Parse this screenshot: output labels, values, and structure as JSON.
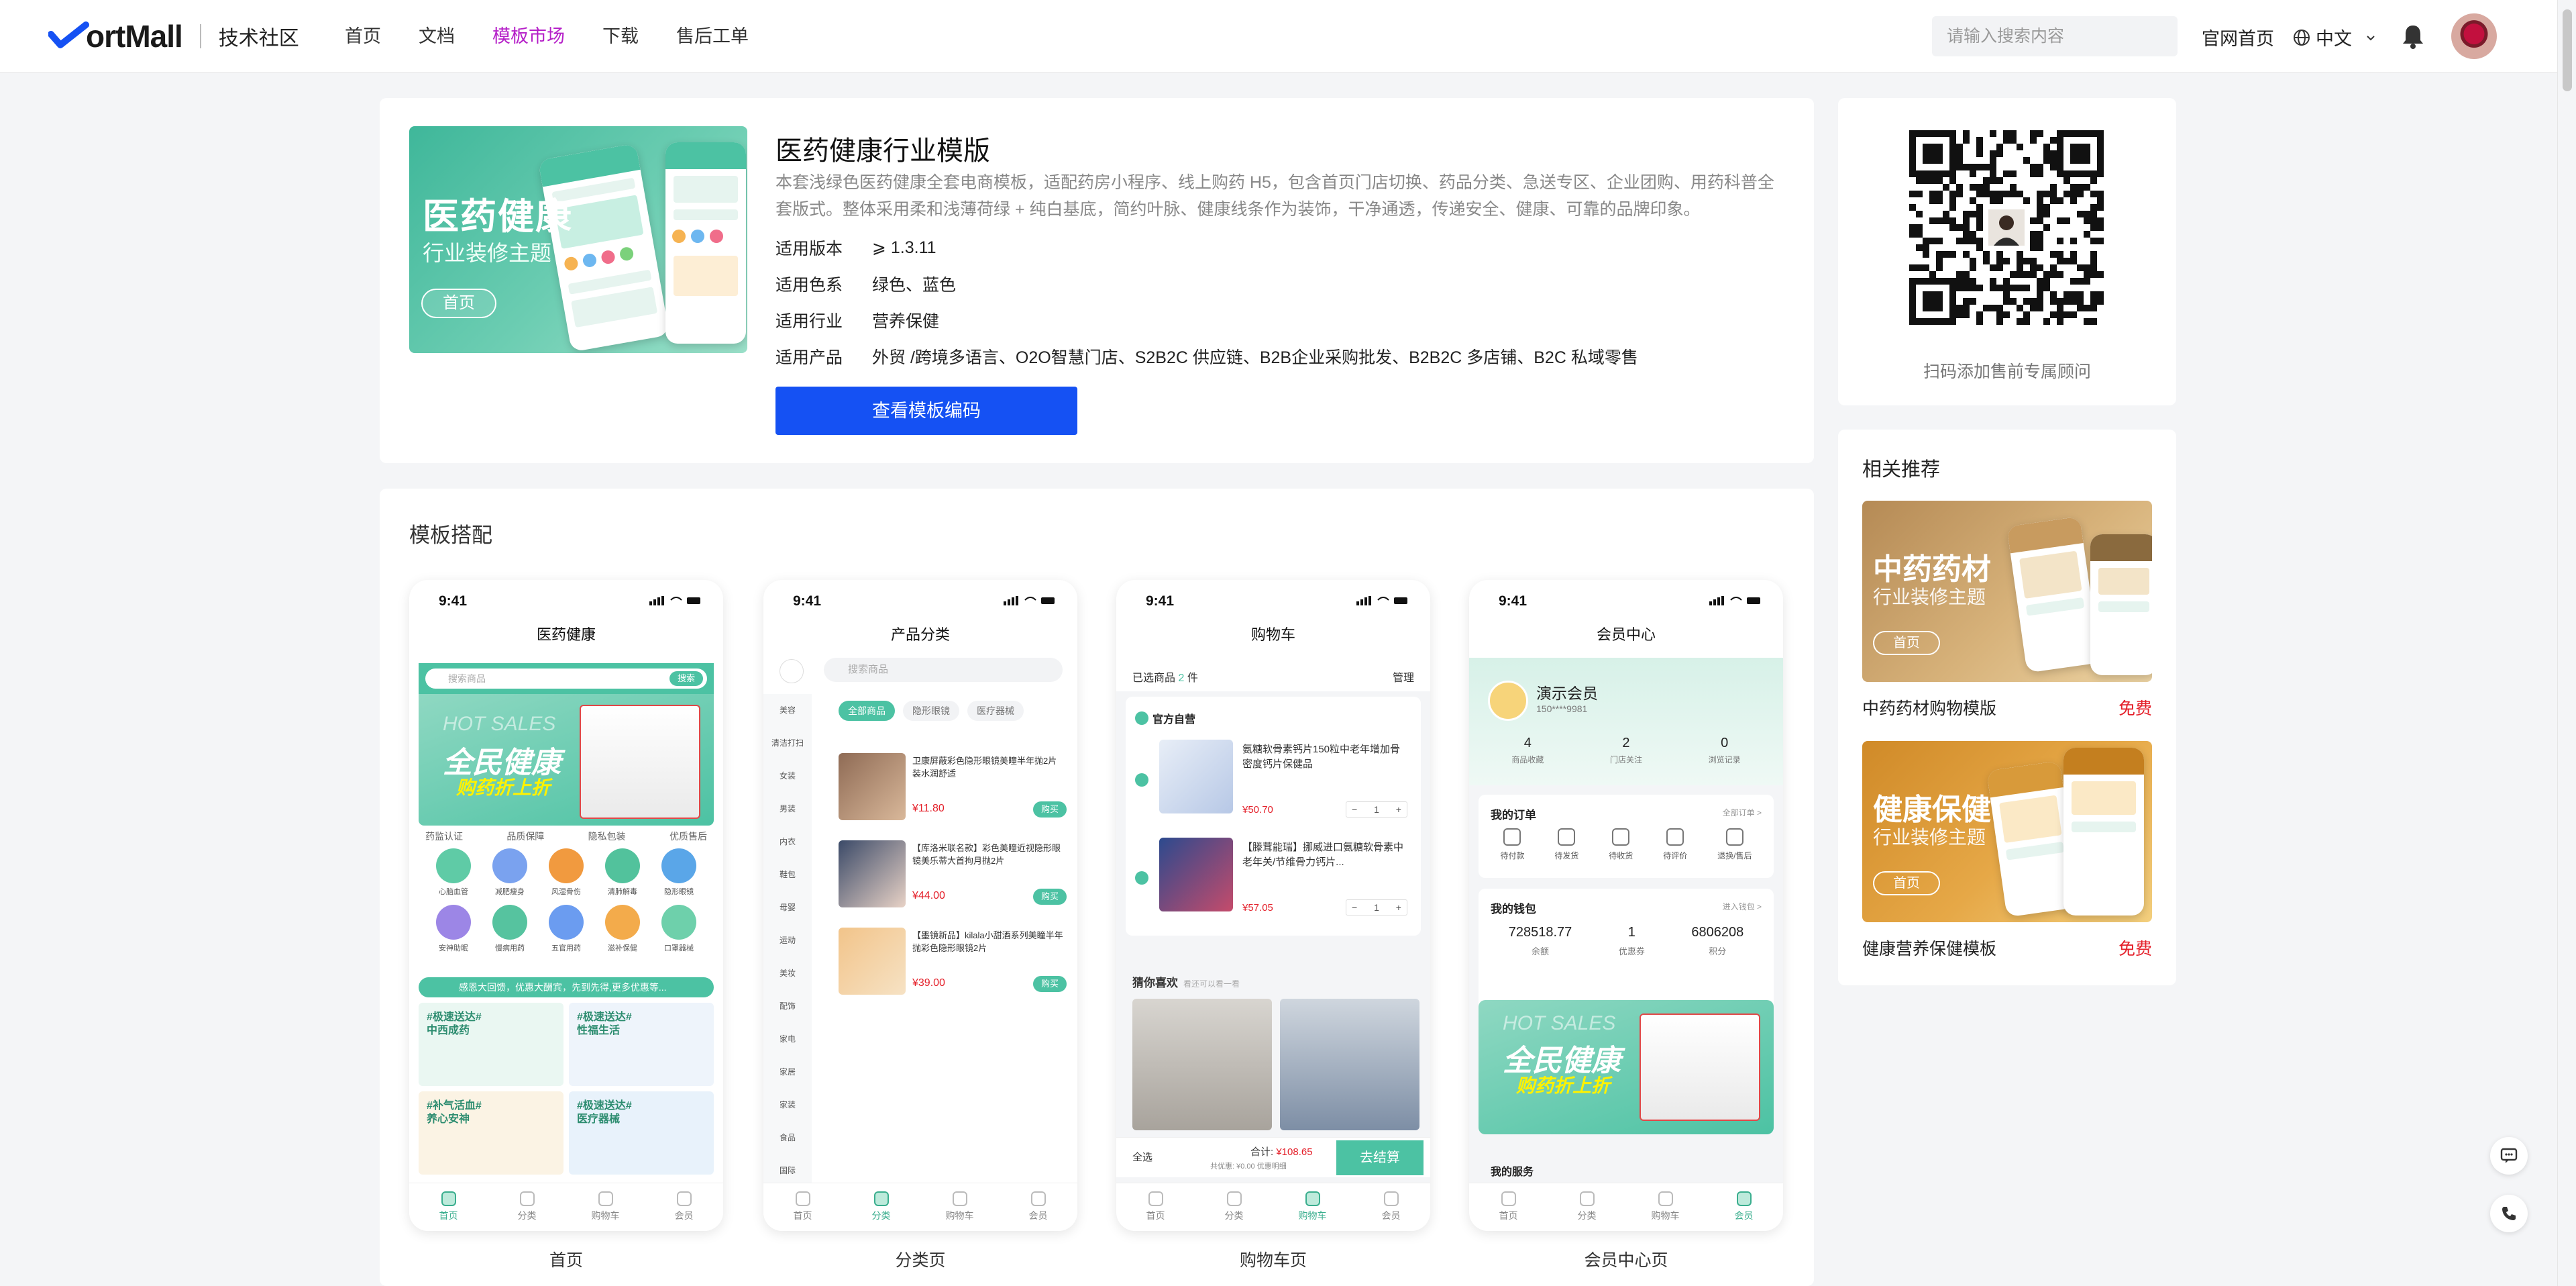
{
  "nav": {
    "logo_text": "ortMall",
    "logo_sub": "技术社区",
    "links": [
      "首页",
      "文档",
      "模板市场",
      "下载",
      "售后工单"
    ],
    "active_index": 2,
    "search_placeholder": "请输入搜索内容",
    "official_site": "官网首页",
    "language": "中文",
    "active_color": "#b51fc8"
  },
  "hero": {
    "banner_title": "医药健康",
    "banner_subtitle": "行业装修主题",
    "banner_button": "首页",
    "title": "医药健康行业模版",
    "description": "本套浅绿色医药健康全套电商模板，适配药房小程序、线上购药 H5，包含首页门店切换、药品分类、急送专区、企业团购、用药科普全套版式。整体采用柔和浅薄荷绿 + 纯白基底，简约叶脉、健康线条作为装饰，干净通透，传递安全、健康、可靠的品牌印象。",
    "specs": [
      {
        "key": "适用版本",
        "value": "⩾ 1.3.11"
      },
      {
        "key": "适用色系",
        "value": "绿色、蓝色"
      },
      {
        "key": "适用行业",
        "value": "营养保健"
      },
      {
        "key": "适用产品",
        "value": "外贸 /跨境多语言、O2O智慧门店、S2B2C 供应链、B2B企业采购批发、B2B2C 多店铺、B2C 私域零售"
      }
    ],
    "cta": "查看模板编码",
    "primary_color": "#1551f3"
  },
  "qr": {
    "caption": "扫码添加售前专属顾问"
  },
  "related": {
    "title": "相关推荐",
    "items": [
      {
        "img_title": "中药药材",
        "img_sub": "行业装修主题",
        "img_btn": "首页",
        "name": "中药药材购物模版",
        "price": "免费"
      },
      {
        "img_title": "健康保健",
        "img_sub": "行业装修主题",
        "img_btn": "首页",
        "name": "健康营养保健模板",
        "price": "免费"
      }
    ],
    "free_color": "#e4202a"
  },
  "templates": {
    "title": "模板搭配",
    "phones": [
      {
        "label": "首页",
        "time": "9:41",
        "header": "医药健康",
        "search": "搜索商品",
        "search_btn": "搜索",
        "hero_tag": "HOT SALES",
        "hero_title": "全民健康",
        "hero_sub": "购药折上折",
        "tags": [
          "药监认证",
          "品质保障",
          "隐私包装",
          "优质售后"
        ],
        "grid": [
          "心脑血管",
          "减肥瘦身",
          "风湿骨伤",
          "清肺解毒",
          "隐形眼镜",
          "安神助眠",
          "慢病用药",
          "五官用药",
          "滋补保健",
          "口罩器械"
        ],
        "notice": "感恩大回馈，优惠大酬宾，先到先得,更多优惠等...",
        "tiles": [
          "#极速送达#\n中西成药",
          "#极速送达#\n性福生活",
          "#补气活血#\n养心安神",
          "#极速送达#\n医疗器械"
        ],
        "tabs": [
          "首页",
          "分类",
          "购物车",
          "会员"
        ],
        "active_tab": 0
      },
      {
        "label": "分类页",
        "time": "9:41",
        "header": "产品分类",
        "search": "搜索商品",
        "sidebar": [
          "美容",
          "清洁打扫",
          "女装",
          "男装",
          "内衣",
          "鞋包",
          "母婴",
          "运动",
          "美妆",
          "配饰",
          "家电",
          "家居",
          "家装",
          "食品",
          "国际"
        ],
        "chips": [
          "全部商品",
          "隐形眼镜",
          "医疗器械"
        ],
        "items": [
          {
            "title": "卫康屏蔽彩色隐形眼镜美瞳半年抛2片装水润舒适",
            "price": "¥11.80",
            "btn": "购买"
          },
          {
            "title": "【库洛米联名款】彩色美瞳近视隐形眼镜美乐蒂大首拘月抛2片",
            "price": "¥44.00",
            "btn": "购买"
          },
          {
            "title": "【墨镜新品】kilala小甜酒系列美瞳半年抛彩色隐形眼镜2片",
            "price": "¥39.00",
            "btn": "购买"
          }
        ],
        "tabs": [
          "首页",
          "分类",
          "购物车",
          "会员"
        ],
        "active_tab": 1
      },
      {
        "label": "购物车页",
        "time": "9:41",
        "header": "购物车",
        "selected": "已选商品",
        "selected_count": "2",
        "selected_unit": "件",
        "manage": "管理",
        "shop": "官方自营",
        "items": [
          {
            "title": "氨糖软骨素钙片150粒中老年增加骨密度钙片保健品",
            "price": "¥50.70",
            "qty": "1"
          },
          {
            "title": "【滕茸能瑞】挪威进口氨糖软骨素中老年关/节维骨力钙片...",
            "price": "¥57.05",
            "qty": "1"
          }
        ],
        "like": "猜你喜欢",
        "like_sub": "看还可以看一看",
        "select_all": "全选",
        "total": "合计:",
        "total_value": "¥108.65",
        "discount": "共优惠: ¥0.00",
        "discount_detail": "优惠明细",
        "pay": "去结算",
        "tabs": [
          "首页",
          "分类",
          "购物车",
          "会员"
        ],
        "active_tab": 2
      },
      {
        "label": "会员中心页",
        "time": "9:41",
        "header": "会员中心",
        "name": "演示会员",
        "phone": "150****9981",
        "stats": [
          {
            "n": "4",
            "l": "商品收藏"
          },
          {
            "n": "2",
            "l": "门店关注"
          },
          {
            "n": "0",
            "l": "浏览记录"
          }
        ],
        "orders_title": "我的订单",
        "orders_more": "全部订单 >",
        "orders": [
          "待付款",
          "待发货",
          "待收货",
          "待评价",
          "退换/售后"
        ],
        "wallet_title": "我的钱包",
        "wallet_more": "进入钱包 >",
        "wallet": [
          {
            "n": "728518.77",
            "l": "余额"
          },
          {
            "n": "1",
            "l": "优惠券"
          },
          {
            "n": "6806208",
            "l": "积分"
          }
        ],
        "ad_tag": "HOT SALES",
        "ad_title": "全民健康",
        "ad_sub": "购药折上折",
        "services": "我的服务",
        "tabs": [
          "首页",
          "分类",
          "购物车",
          "会员"
        ],
        "active_tab": 3
      }
    ]
  }
}
